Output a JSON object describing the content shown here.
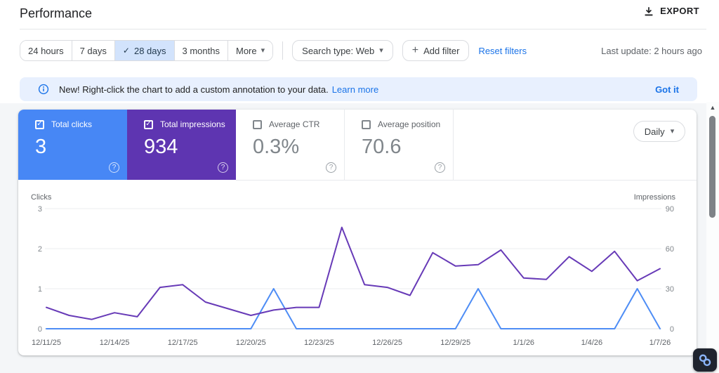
{
  "header": {
    "title": "Performance",
    "export_label": "EXPORT"
  },
  "filters": {
    "date_ranges": [
      {
        "label": "24 hours",
        "selected": false
      },
      {
        "label": "7 days",
        "selected": false
      },
      {
        "label": "28 days",
        "selected": true
      },
      {
        "label": "3 months",
        "selected": false
      },
      {
        "label": "More",
        "selected": false,
        "has_dropdown": true
      }
    ],
    "search_type_label": "Search type: Web",
    "add_filter_label": "Add filter",
    "reset_filters_label": "Reset filters",
    "last_update": "Last update: 2 hours ago"
  },
  "banner": {
    "text": "New! Right-click the chart to add a custom annotation to your data.",
    "learn_more_label": "Learn more",
    "got_it_label": "Got it"
  },
  "metrics": {
    "granularity": "Daily",
    "cards": [
      {
        "label": "Total clicks",
        "value": "3",
        "checked": true,
        "color": "#4787f5"
      },
      {
        "label": "Total impressions",
        "value": "934",
        "checked": true,
        "color": "#5e35b1"
      },
      {
        "label": "Average CTR",
        "value": "0.3%",
        "checked": false
      },
      {
        "label": "Average position",
        "value": "70.6",
        "checked": false
      }
    ]
  },
  "chart_data": {
    "type": "line",
    "x": [
      "12/11/25",
      "12/12/25",
      "12/13/25",
      "12/14/25",
      "12/15/25",
      "12/16/25",
      "12/17/25",
      "12/18/25",
      "12/19/25",
      "12/20/25",
      "12/21/25",
      "12/22/25",
      "12/23/25",
      "12/24/25",
      "12/25/25",
      "12/26/25",
      "12/27/25",
      "12/28/25",
      "12/29/25",
      "12/30/25",
      "12/31/25",
      "1/1/26",
      "1/2/26",
      "1/3/26",
      "1/4/26",
      "1/5/26",
      "1/6/26",
      "1/7/26"
    ],
    "x_tick_labels": [
      "12/11/25",
      "12/14/25",
      "12/17/25",
      "12/20/25",
      "12/23/25",
      "12/26/25",
      "12/29/25",
      "1/1/26",
      "1/4/26",
      "1/7/26"
    ],
    "left_axis": {
      "label": "Clicks",
      "ticks": [
        0,
        1,
        2,
        3
      ],
      "max": 3
    },
    "right_axis": {
      "label": "Impressions",
      "ticks": [
        0,
        30,
        60,
        90
      ],
      "max": 90
    },
    "grid": true,
    "legend": "none",
    "series": [
      {
        "name": "Clicks",
        "axis": "left",
        "color": "#4e8df5",
        "values": [
          0,
          0,
          0,
          0,
          0,
          0,
          0,
          0,
          0,
          0,
          1,
          0,
          0,
          0,
          0,
          0,
          0,
          0,
          0,
          1,
          0,
          0,
          0,
          0,
          0,
          0,
          1,
          0
        ]
      },
      {
        "name": "Impressions",
        "axis": "right",
        "color": "#673ab7",
        "values": [
          16,
          10,
          7,
          12,
          9,
          31,
          33,
          20,
          15,
          10,
          14,
          16,
          16,
          76,
          33,
          31,
          25,
          57,
          47,
          48,
          59,
          38,
          37,
          54,
          43,
          58,
          36,
          45
        ]
      }
    ]
  },
  "icons": {
    "caret": "▾",
    "plus": "+",
    "check": "✓",
    "help": "?",
    "scroll_up": "▲"
  },
  "colors": {
    "link": "#1a73e8",
    "selected_chip_bg": "#d2e3fc",
    "banner_bg": "#e8f0fe",
    "border": "#dadce0",
    "muted_text": "#5f6368",
    "clicks_line": "#4e8df5",
    "impressions_line": "#673ab7"
  }
}
